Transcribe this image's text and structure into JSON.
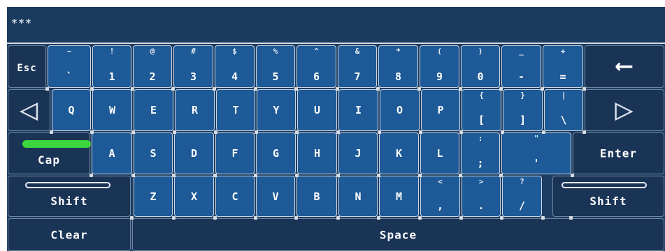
{
  "display": {
    "text": "***"
  },
  "row1": [
    {
      "name": "esc",
      "main": "Esc"
    },
    {
      "name": "backtick",
      "shift": "~",
      "main": "`"
    },
    {
      "name": "1",
      "shift": "!",
      "main": "1"
    },
    {
      "name": "2",
      "shift": "@",
      "main": "2"
    },
    {
      "name": "3",
      "shift": "#",
      "main": "3"
    },
    {
      "name": "4",
      "shift": "$",
      "main": "4"
    },
    {
      "name": "5",
      "shift": "%",
      "main": "5"
    },
    {
      "name": "6",
      "shift": "^",
      "main": "6"
    },
    {
      "name": "7",
      "shift": "&",
      "main": "7"
    },
    {
      "name": "8",
      "shift": "*",
      "main": "8"
    },
    {
      "name": "9",
      "shift": "(",
      "main": "9"
    },
    {
      "name": "0",
      "shift": ")",
      "main": "0"
    },
    {
      "name": "minus",
      "shift": "_",
      "main": "-"
    },
    {
      "name": "equals",
      "shift": "+",
      "main": "="
    },
    {
      "name": "backspace",
      "main": "⟵"
    }
  ],
  "row2": [
    {
      "name": "left",
      "main": "◁"
    },
    {
      "name": "q",
      "main": "Q"
    },
    {
      "name": "w",
      "main": "W"
    },
    {
      "name": "e",
      "main": "E"
    },
    {
      "name": "r",
      "main": "R"
    },
    {
      "name": "t",
      "main": "T"
    },
    {
      "name": "y",
      "main": "Y"
    },
    {
      "name": "u",
      "main": "U"
    },
    {
      "name": "i",
      "main": "I"
    },
    {
      "name": "o",
      "main": "O"
    },
    {
      "name": "p",
      "main": "P"
    },
    {
      "name": "lbracket",
      "shift": "{",
      "main": "["
    },
    {
      "name": "rbracket",
      "shift": "}",
      "main": "]"
    },
    {
      "name": "backslash",
      "shift": "|",
      "main": "\\"
    },
    {
      "name": "right",
      "main": "▷"
    }
  ],
  "row3": [
    {
      "name": "caps",
      "main": "Cap"
    },
    {
      "name": "a",
      "main": "A"
    },
    {
      "name": "s",
      "main": "S"
    },
    {
      "name": "d",
      "main": "D"
    },
    {
      "name": "f",
      "main": "F"
    },
    {
      "name": "g",
      "main": "G"
    },
    {
      "name": "h",
      "main": "H"
    },
    {
      "name": "j",
      "main": "J"
    },
    {
      "name": "k",
      "main": "K"
    },
    {
      "name": "l",
      "main": "L"
    },
    {
      "name": "semicolon",
      "shift": ":",
      "main": ";"
    },
    {
      "name": "quote",
      "shift": "\"",
      "main": "'"
    },
    {
      "name": "enter",
      "main": "Enter"
    }
  ],
  "row4": [
    {
      "name": "shift-left",
      "main": "Shift"
    },
    {
      "name": "z",
      "main": "Z"
    },
    {
      "name": "x",
      "main": "X"
    },
    {
      "name": "c",
      "main": "C"
    },
    {
      "name": "v",
      "main": "V"
    },
    {
      "name": "b",
      "main": "B"
    },
    {
      "name": "n",
      "main": "N"
    },
    {
      "name": "m",
      "main": "M"
    },
    {
      "name": "comma",
      "shift": "<",
      "main": ","
    },
    {
      "name": "period",
      "shift": ">",
      "main": "."
    },
    {
      "name": "slash",
      "shift": "?",
      "main": "/"
    },
    {
      "name": "shift-right",
      "main": "Shift"
    }
  ],
  "row5": [
    {
      "name": "clear",
      "main": "Clear"
    },
    {
      "name": "space",
      "main": "Space"
    }
  ],
  "state": {
    "caps_on": true,
    "shift_on": false
  },
  "colors": {
    "key": "#1d5a97",
    "dark_key": "#1a3456",
    "caps_led": "#3dd63d"
  }
}
